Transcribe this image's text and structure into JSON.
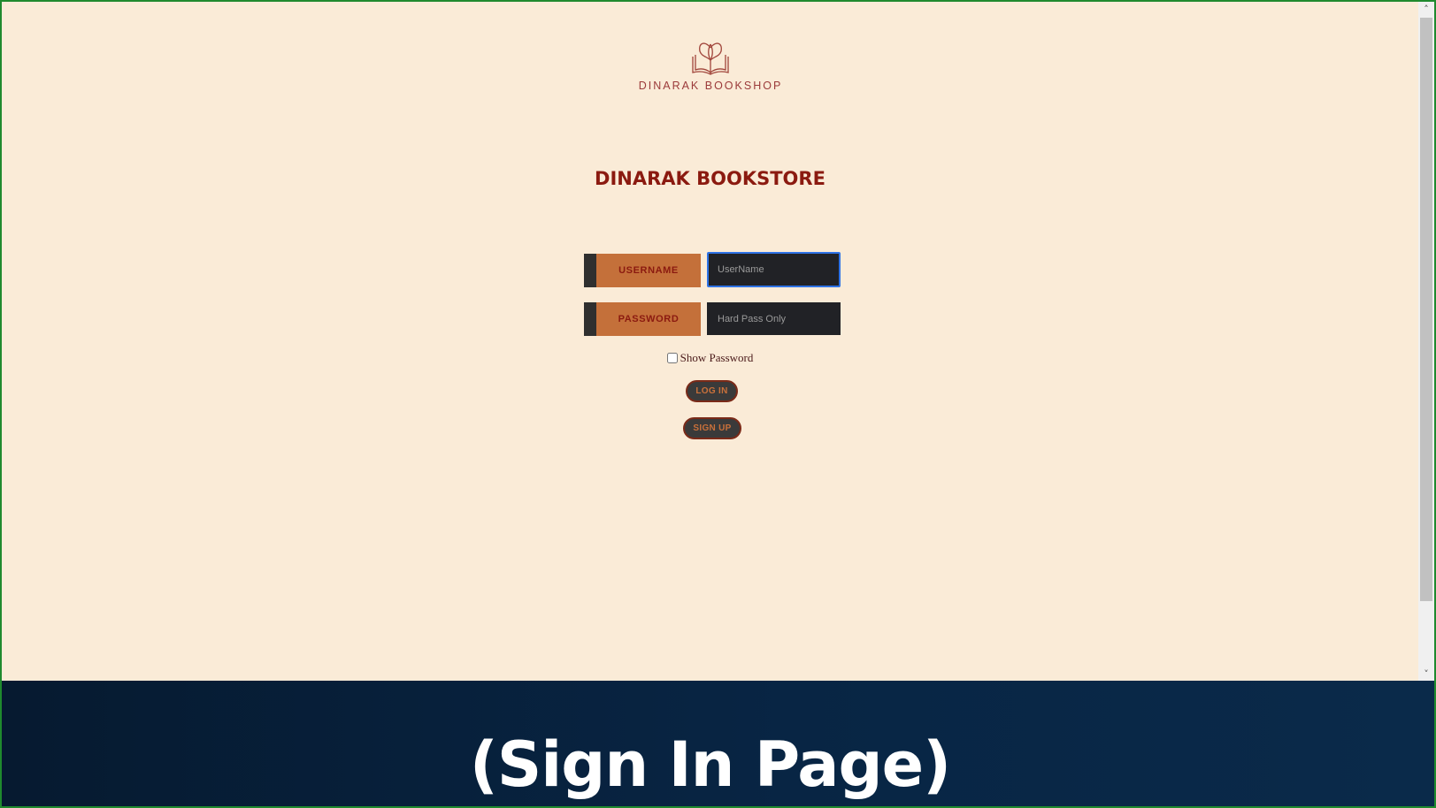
{
  "brand": {
    "logo_icon": "open-book-tree-icon",
    "logo_text": "DINARAK BOOKSHOP",
    "accent": "#8b1a10",
    "background": "#faebd7"
  },
  "page": {
    "title": "DINARAK BOOKSTORE"
  },
  "form": {
    "username_label": "USERNAME",
    "username_placeholder": "UserName",
    "username_value": "",
    "password_label": "PASSWORD",
    "password_placeholder": "Hard Pass Only",
    "password_value": "",
    "show_password_label": "Show Password",
    "show_password_checked": false,
    "login_label": "LOG IN",
    "signup_label": "SIGN UP"
  },
  "caption": {
    "text": "(Sign In Page)"
  }
}
